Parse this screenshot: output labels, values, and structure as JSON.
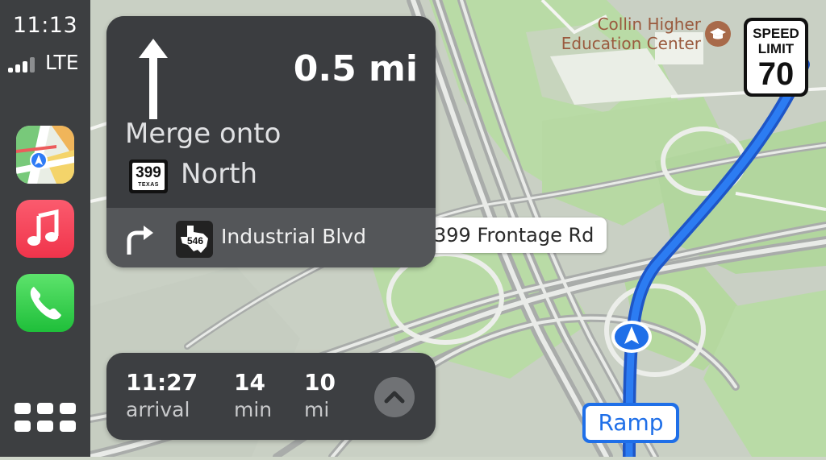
{
  "status": {
    "time": "11:13",
    "network": "LTE"
  },
  "sidebar": {
    "apps": [
      {
        "name": "Maps",
        "icon": "maps-app-icon"
      },
      {
        "name": "Music",
        "icon": "music-app-icon"
      },
      {
        "name": "Phone",
        "icon": "phone-app-icon"
      }
    ],
    "grid_icon": "app-grid-icon"
  },
  "maneuver": {
    "distance": "0.5 mi",
    "instruction": "Merge onto",
    "road_shield_number": "399",
    "road_shield_state": "TEXAS",
    "direction": "North",
    "next_shield_number": "546",
    "next_street": "Industrial Blvd"
  },
  "eta": {
    "arrival_value": "11:27",
    "arrival_label": "arrival",
    "duration_value": "14",
    "duration_label": "min",
    "distance_value": "10",
    "distance_label": "mi"
  },
  "map": {
    "poi_line1": "Collin Higher",
    "poi_line2": "Education Center",
    "speed_limit_header": "SPEED\nLIMIT",
    "speed_limit_value": "70",
    "road_label": "399 Frontage Rd",
    "ramp_label": "Ramp"
  },
  "colors": {
    "route": "#1f6fe8",
    "sidebar": "#3d3f41",
    "card": "#3b3d40",
    "poi": "#9a5a3e"
  }
}
